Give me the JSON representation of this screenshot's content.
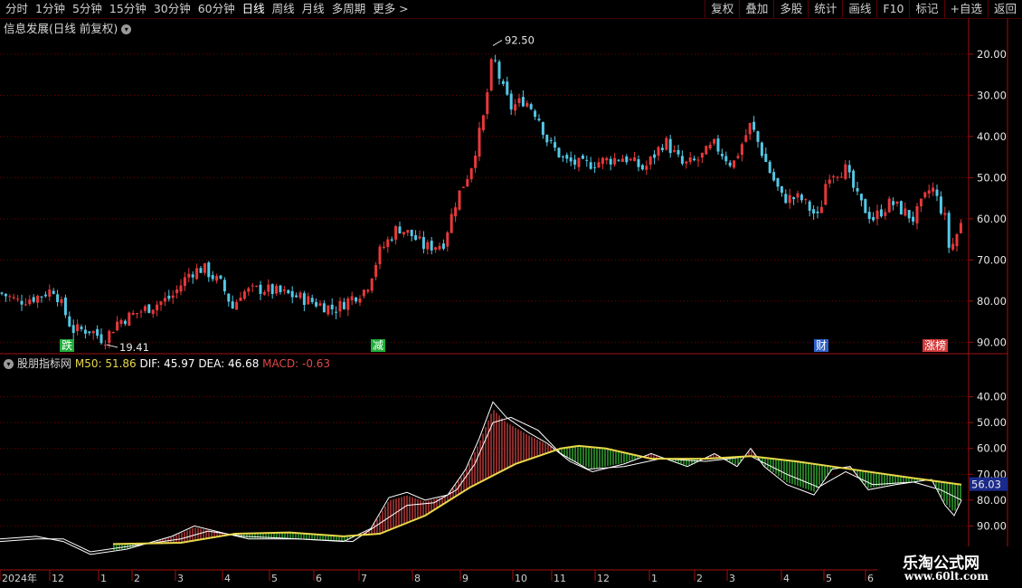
{
  "toolbar": {
    "periods": [
      "分时",
      "1分钟",
      "5分钟",
      "15分钟",
      "30分钟",
      "60分钟",
      "日线",
      "周线",
      "月线",
      "多周期",
      "更多 >"
    ],
    "active_period": "日线",
    "actions": [
      "复权",
      "叠加",
      "多股",
      "统计",
      "画线",
      "F10",
      "标记",
      "+自选",
      "返回"
    ]
  },
  "main_chart": {
    "title": "信息发展(日线 前复权)",
    "high_label": "92.50",
    "low_label": "19.41",
    "y_ticks": [
      "90.00",
      "80.00",
      "70.00",
      "60.00",
      "50.00",
      "40.00",
      "30.00",
      "20.00"
    ],
    "markers": [
      {
        "text": "跌",
        "color": "#1fae3a"
      },
      {
        "text": "减",
        "color": "#1fae3a"
      },
      {
        "text": "财",
        "color": "#2f62c8"
      },
      {
        "text": "涨榜",
        "color": "#d23a3a"
      }
    ]
  },
  "indicator": {
    "name": "股朋指标网",
    "m50_label": "M50: 51.86",
    "dif_label": "DIF: 45.97",
    "dea_label": "DEA: 46.68",
    "macd_label": "MACD: -0.63",
    "y_ticks": [
      "90.00",
      "80.00",
      "70.00",
      "60.00",
      "50.00",
      "40.00"
    ],
    "current_value": "56.03",
    "colors": {
      "m50": "#e8d84a",
      "dif": "#ffffff",
      "dea": "#ffffff",
      "macd_up": "#e04848",
      "macd_down": "#3cc83c"
    }
  },
  "date_axis": {
    "labels": [
      "2024年",
      "12",
      "1",
      "2",
      "3",
      "4",
      "5",
      "6",
      "7",
      "8",
      "9",
      "10",
      "11",
      "12",
      "1",
      "2",
      "3",
      "4",
      "5",
      "6"
    ]
  },
  "watermark": {
    "line1": "乐淘公式网",
    "line2": "www.60lt.com"
  },
  "chart_data": {
    "type": "candlestick",
    "title": "信息发展(日线 前复权)",
    "ylim": [
      17,
      97
    ],
    "y_ticks": [
      20,
      30,
      40,
      50,
      60,
      70,
      80,
      90
    ],
    "high": 92.5,
    "low": 19.41,
    "close_path": [
      {
        "x": 0,
        "y": 32
      },
      {
        "x": 20,
        "y": 30
      },
      {
        "x": 40,
        "y": 31
      },
      {
        "x": 60,
        "y": 33
      },
      {
        "x": 70,
        "y": 28
      },
      {
        "x": 80,
        "y": 23
      },
      {
        "x": 100,
        "y": 23
      },
      {
        "x": 115,
        "y": 20.5
      },
      {
        "x": 130,
        "y": 25
      },
      {
        "x": 160,
        "y": 28
      },
      {
        "x": 190,
        "y": 31
      },
      {
        "x": 210,
        "y": 37
      },
      {
        "x": 225,
        "y": 38
      },
      {
        "x": 245,
        "y": 34
      },
      {
        "x": 258,
        "y": 28
      },
      {
        "x": 265,
        "y": 32
      },
      {
        "x": 290,
        "y": 33
      },
      {
        "x": 330,
        "y": 31
      },
      {
        "x": 370,
        "y": 28
      },
      {
        "x": 390,
        "y": 31
      },
      {
        "x": 405,
        "y": 33
      },
      {
        "x": 420,
        "y": 42
      },
      {
        "x": 440,
        "y": 48
      },
      {
        "x": 455,
        "y": 46
      },
      {
        "x": 470,
        "y": 43
      },
      {
        "x": 490,
        "y": 44
      },
      {
        "x": 505,
        "y": 55
      },
      {
        "x": 520,
        "y": 62
      },
      {
        "x": 535,
        "y": 75
      },
      {
        "x": 545,
        "y": 90
      },
      {
        "x": 555,
        "y": 82
      },
      {
        "x": 565,
        "y": 77
      },
      {
        "x": 580,
        "y": 79
      },
      {
        "x": 595,
        "y": 75
      },
      {
        "x": 605,
        "y": 69
      },
      {
        "x": 625,
        "y": 64
      },
      {
        "x": 645,
        "y": 63
      },
      {
        "x": 665,
        "y": 64
      },
      {
        "x": 690,
        "y": 65
      },
      {
        "x": 712,
        "y": 62
      },
      {
        "x": 735,
        "y": 69
      },
      {
        "x": 755,
        "y": 63
      },
      {
        "x": 770,
        "y": 64
      },
      {
        "x": 790,
        "y": 68
      },
      {
        "x": 810,
        "y": 63
      },
      {
        "x": 830,
        "y": 73
      },
      {
        "x": 850,
        "y": 62
      },
      {
        "x": 865,
        "y": 55
      },
      {
        "x": 885,
        "y": 55
      },
      {
        "x": 905,
        "y": 50
      },
      {
        "x": 915,
        "y": 61
      },
      {
        "x": 935,
        "y": 62
      },
      {
        "x": 950,
        "y": 54
      },
      {
        "x": 965,
        "y": 50
      },
      {
        "x": 985,
        "y": 54
      },
      {
        "x": 1010,
        "y": 50
      },
      {
        "x": 1030,
        "y": 58
      },
      {
        "x": 1045,
        "y": 50
      },
      {
        "x": 1050,
        "y": 42
      },
      {
        "x": 1063,
        "y": 49
      }
    ],
    "indicator": {
      "ylim": [
        30,
        100
      ],
      "y_ticks": [
        40,
        50,
        60,
        70,
        80,
        90
      ],
      "m50": [
        {
          "x": 125,
          "y": 33
        },
        {
          "x": 200,
          "y": 33.5
        },
        {
          "x": 260,
          "y": 37
        },
        {
          "x": 320,
          "y": 37.5
        },
        {
          "x": 380,
          "y": 36
        },
        {
          "x": 420,
          "y": 37
        },
        {
          "x": 470,
          "y": 44
        },
        {
          "x": 520,
          "y": 55
        },
        {
          "x": 570,
          "y": 64
        },
        {
          "x": 620,
          "y": 70
        },
        {
          "x": 640,
          "y": 71
        },
        {
          "x": 670,
          "y": 70
        },
        {
          "x": 720,
          "y": 66
        },
        {
          "x": 780,
          "y": 66
        },
        {
          "x": 830,
          "y": 67
        },
        {
          "x": 880,
          "y": 65
        },
        {
          "x": 940,
          "y": 62
        },
        {
          "x": 1000,
          "y": 59
        },
        {
          "x": 1063,
          "y": 56
        }
      ],
      "dif": [
        {
          "x": 0,
          "y": 35
        },
        {
          "x": 40,
          "y": 36
        },
        {
          "x": 70,
          "y": 34
        },
        {
          "x": 100,
          "y": 29
        },
        {
          "x": 140,
          "y": 31
        },
        {
          "x": 190,
          "y": 36
        },
        {
          "x": 215,
          "y": 40
        },
        {
          "x": 250,
          "y": 37
        },
        {
          "x": 275,
          "y": 35
        },
        {
          "x": 330,
          "y": 35
        },
        {
          "x": 380,
          "y": 34
        },
        {
          "x": 410,
          "y": 39
        },
        {
          "x": 430,
          "y": 51
        },
        {
          "x": 450,
          "y": 53
        },
        {
          "x": 470,
          "y": 50
        },
        {
          "x": 495,
          "y": 52
        },
        {
          "x": 515,
          "y": 62
        },
        {
          "x": 530,
          "y": 74
        },
        {
          "x": 545,
          "y": 88
        },
        {
          "x": 560,
          "y": 82
        },
        {
          "x": 585,
          "y": 76
        },
        {
          "x": 605,
          "y": 72
        },
        {
          "x": 630,
          "y": 65
        },
        {
          "x": 655,
          "y": 61
        },
        {
          "x": 690,
          "y": 64
        },
        {
          "x": 720,
          "y": 68
        },
        {
          "x": 760,
          "y": 63
        },
        {
          "x": 790,
          "y": 68
        },
        {
          "x": 815,
          "y": 63
        },
        {
          "x": 830,
          "y": 70
        },
        {
          "x": 845,
          "y": 63
        },
        {
          "x": 870,
          "y": 56
        },
        {
          "x": 900,
          "y": 52
        },
        {
          "x": 920,
          "y": 62
        },
        {
          "x": 940,
          "y": 63
        },
        {
          "x": 960,
          "y": 54
        },
        {
          "x": 990,
          "y": 56
        },
        {
          "x": 1030,
          "y": 58
        },
        {
          "x": 1045,
          "y": 48
        },
        {
          "x": 1055,
          "y": 44
        },
        {
          "x": 1063,
          "y": 50
        }
      ],
      "dea": [
        {
          "x": 0,
          "y": 34
        },
        {
          "x": 40,
          "y": 35
        },
        {
          "x": 70,
          "y": 35
        },
        {
          "x": 100,
          "y": 30
        },
        {
          "x": 140,
          "y": 32
        },
        {
          "x": 200,
          "y": 35
        },
        {
          "x": 230,
          "y": 38
        },
        {
          "x": 270,
          "y": 36
        },
        {
          "x": 330,
          "y": 35
        },
        {
          "x": 390,
          "y": 34
        },
        {
          "x": 420,
          "y": 41
        },
        {
          "x": 450,
          "y": 48
        },
        {
          "x": 480,
          "y": 49
        },
        {
          "x": 505,
          "y": 54
        },
        {
          "x": 525,
          "y": 64
        },
        {
          "x": 545,
          "y": 80
        },
        {
          "x": 565,
          "y": 82
        },
        {
          "x": 595,
          "y": 77
        },
        {
          "x": 620,
          "y": 68
        },
        {
          "x": 650,
          "y": 62
        },
        {
          "x": 690,
          "y": 63
        },
        {
          "x": 730,
          "y": 66
        },
        {
          "x": 780,
          "y": 65
        },
        {
          "x": 830,
          "y": 67
        },
        {
          "x": 870,
          "y": 60
        },
        {
          "x": 905,
          "y": 55
        },
        {
          "x": 935,
          "y": 61
        },
        {
          "x": 965,
          "y": 56
        },
        {
          "x": 1010,
          "y": 57
        },
        {
          "x": 1040,
          "y": 54
        },
        {
          "x": 1063,
          "y": 50
        }
      ]
    },
    "x_ticks": [
      "2024年",
      "12",
      "1",
      "2",
      "3",
      "4",
      "5",
      "6",
      "7",
      "8",
      "9",
      "10",
      "11",
      "12",
      "1",
      "2",
      "3",
      "4",
      "5",
      "6"
    ]
  }
}
